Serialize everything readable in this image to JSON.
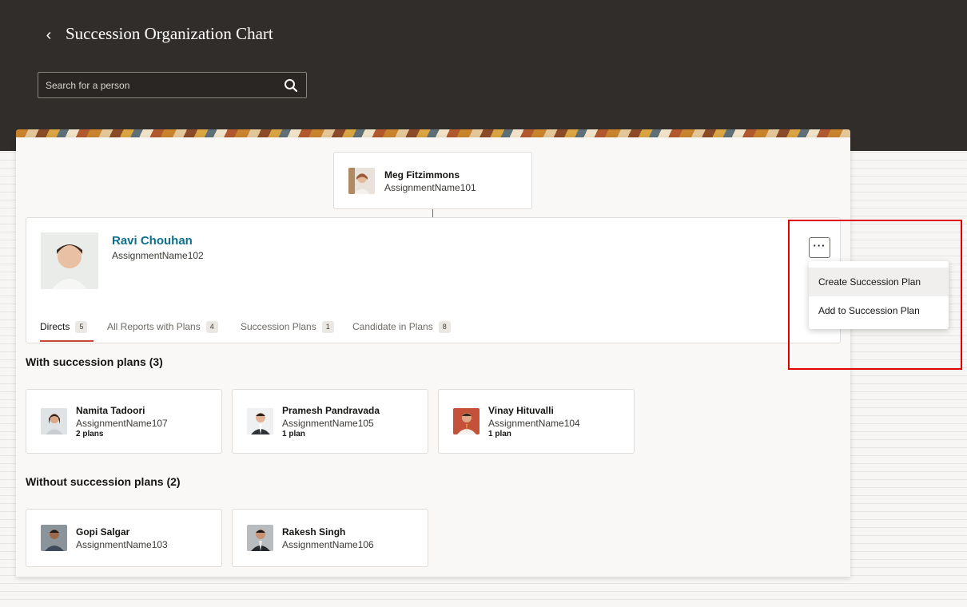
{
  "header": {
    "title": "Succession Organization Chart",
    "search": {
      "placeholder": "Search for a person",
      "value": ""
    }
  },
  "manager": {
    "name": "Meg Fitzimmons",
    "assignment": "AssignmentName101"
  },
  "selected_person": {
    "name": "Ravi Chouhan",
    "assignment": "AssignmentName102",
    "more_actions_label": "···"
  },
  "tabs": [
    {
      "label": "Directs",
      "count": "5",
      "active": true
    },
    {
      "label": "All Reports with Plans",
      "count": "4",
      "active": false
    },
    {
      "label": "Succession Plans",
      "count": "1",
      "active": false
    },
    {
      "label": "Candidate in Plans",
      "count": "8",
      "active": false
    }
  ],
  "actions_menu": {
    "items": [
      {
        "label": "Create Succession Plan"
      },
      {
        "label": "Add to Succession Plan"
      }
    ]
  },
  "with_plans": {
    "title": "With succession plans (3)",
    "people": [
      {
        "name": "Namita Tadoori",
        "assignment": "AssignmentName107",
        "plans": "2 plans"
      },
      {
        "name": "Pramesh Pandravada",
        "assignment": "AssignmentName105",
        "plans": "1 plan"
      },
      {
        "name": "Vinay Hituvalli",
        "assignment": "AssignmentName104",
        "plans": "1 plan"
      }
    ]
  },
  "without_plans": {
    "title": "Without succession plans (2)",
    "people": [
      {
        "name": "Gopi Salgar",
        "assignment": "AssignmentName103"
      },
      {
        "name": "Rakesh Singh",
        "assignment": "AssignmentName106"
      }
    ]
  },
  "colors": {
    "header_bg": "#312d2a",
    "link_name": "#0e6f8a",
    "tab_underline": "#c74634",
    "highlight": "#e00000"
  }
}
